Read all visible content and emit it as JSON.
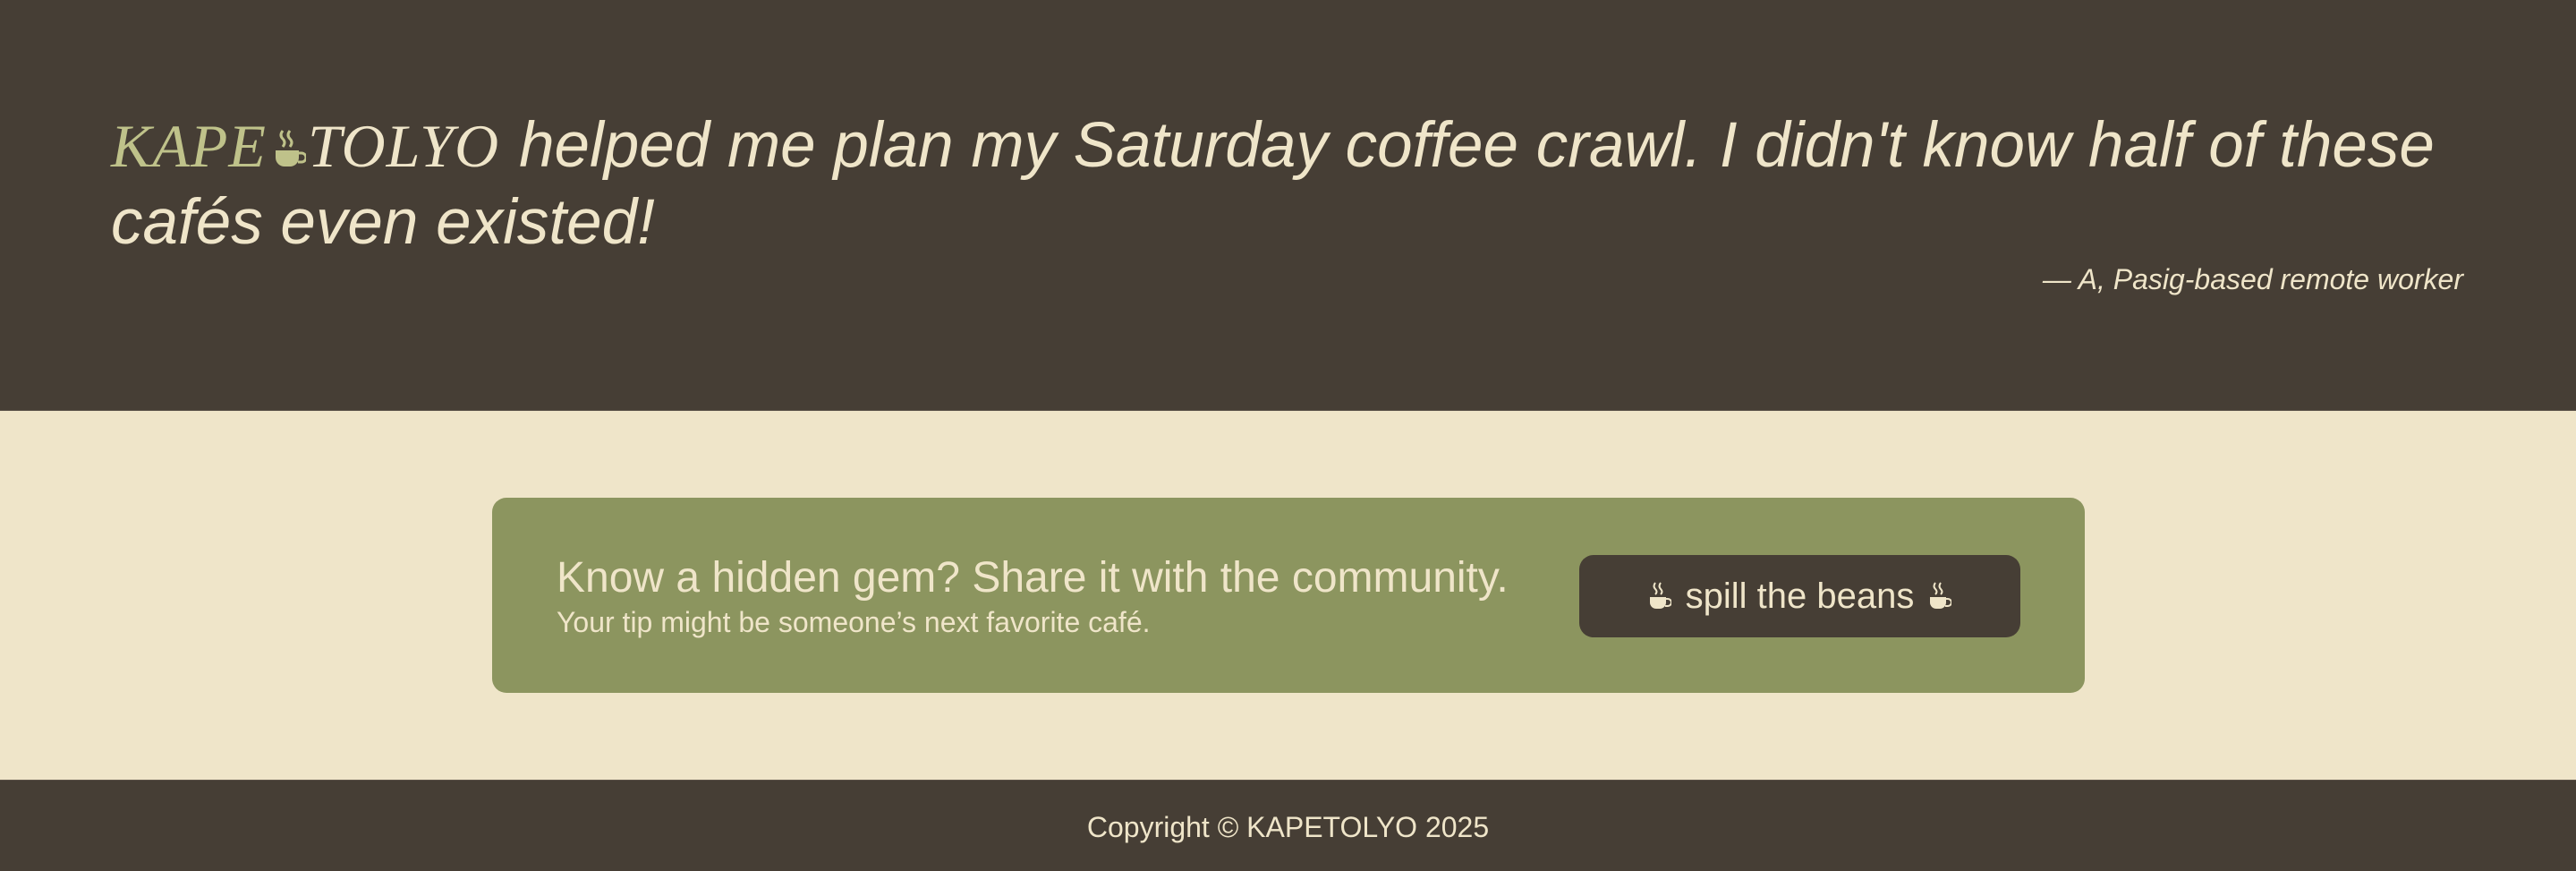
{
  "testimonial": {
    "brand_part1": "KAPE",
    "brand_part2": "TOLYO",
    "quote": "helped me plan my Saturday coffee crawl. I didn't know half of these cafés even existed!",
    "attribution": "— A, Pasig-based remote worker"
  },
  "cta": {
    "heading": "Know a hidden gem? Share it with the community.",
    "subtext": "Your tip might be someone’s next favorite café.",
    "button_label": "spill the beans",
    "button_icon": "coffee-cup-icon"
  },
  "footer": {
    "copyright": "Copyright © KAPETOLYO 2025"
  },
  "colors": {
    "dark_brown": "#463e35",
    "cream": "#efe5c9",
    "olive": "#8c955f",
    "brand_green": "#bfc28a"
  }
}
